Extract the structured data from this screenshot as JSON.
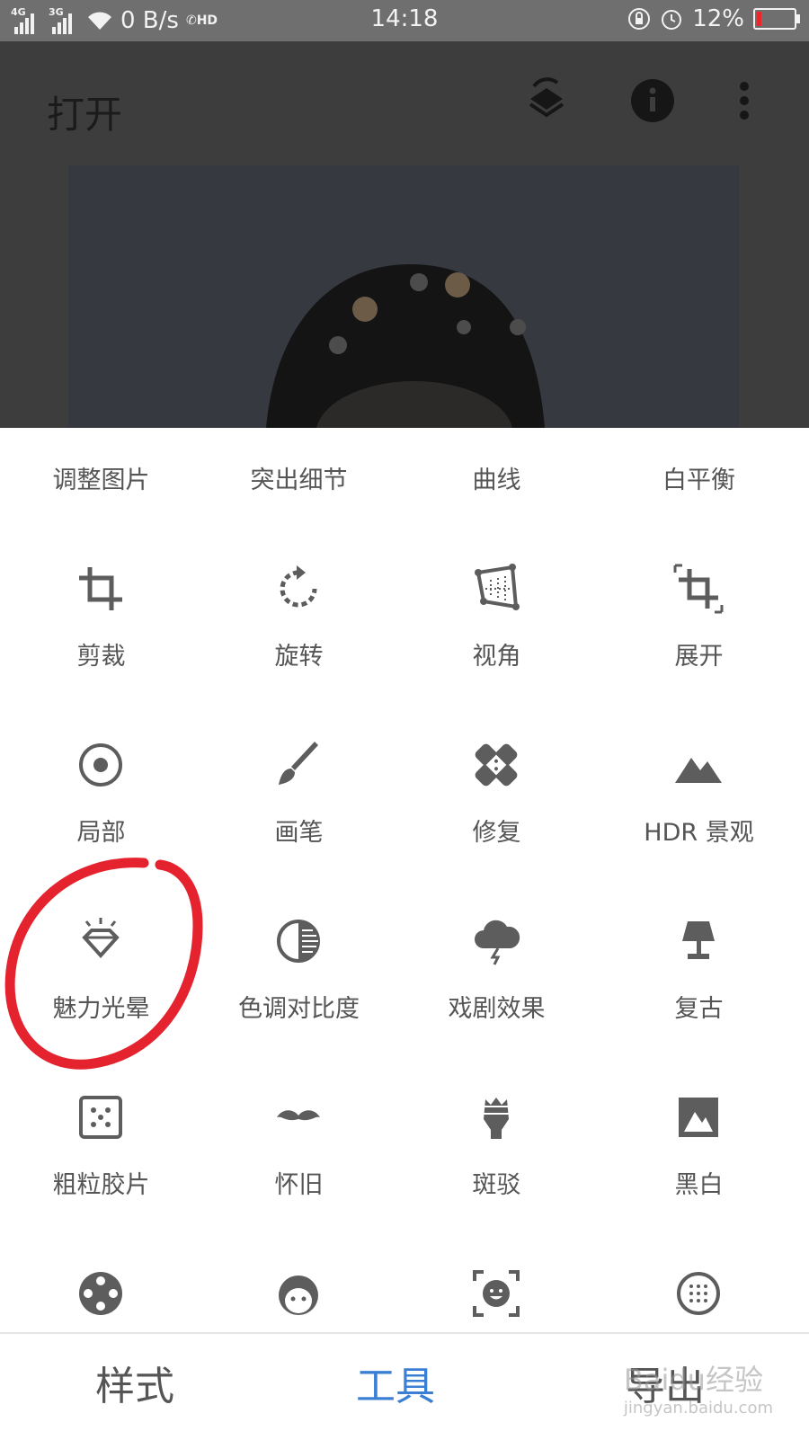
{
  "status_bar": {
    "signal1": "4G",
    "signal2": "3G",
    "speed": "0 B/s",
    "call": "HD",
    "time": "14:18",
    "battery": "12%",
    "battery_color": "#e8262b"
  },
  "header": {
    "title": "打开",
    "icons": [
      "layers-icon",
      "info-icon",
      "more-icon"
    ]
  },
  "tools": [
    {
      "label": "调整图片",
      "icon": "tune-icon"
    },
    {
      "label": "突出细节",
      "icon": "details-icon"
    },
    {
      "label": "曲线",
      "icon": "curves-icon"
    },
    {
      "label": "白平衡",
      "icon": "white-balance-icon"
    },
    {
      "label": "剪裁",
      "icon": "crop-icon"
    },
    {
      "label": "旋转",
      "icon": "rotate-icon"
    },
    {
      "label": "视角",
      "icon": "perspective-icon"
    },
    {
      "label": "展开",
      "icon": "expand-icon"
    },
    {
      "label": "局部",
      "icon": "selective-icon"
    },
    {
      "label": "画笔",
      "icon": "brush-icon"
    },
    {
      "label": "修复",
      "icon": "healing-icon"
    },
    {
      "label": "HDR 景观",
      "icon": "hdr-icon"
    },
    {
      "label": "魅力光晕",
      "icon": "glamour-glow-icon"
    },
    {
      "label": "色调对比度",
      "icon": "tonal-contrast-icon"
    },
    {
      "label": "戏剧效果",
      "icon": "drama-icon"
    },
    {
      "label": "复古",
      "icon": "vintage-icon"
    },
    {
      "label": "粗粒胶片",
      "icon": "grainy-film-icon"
    },
    {
      "label": "怀旧",
      "icon": "retrolux-icon"
    },
    {
      "label": "斑驳",
      "icon": "grunge-icon"
    },
    {
      "label": "黑白",
      "icon": "black-white-icon"
    },
    {
      "label": "",
      "icon": "noir-icon"
    },
    {
      "label": "",
      "icon": "portrait-icon"
    },
    {
      "label": "",
      "icon": "face-pose-icon"
    },
    {
      "label": "",
      "icon": "lens-blur-icon"
    }
  ],
  "bottom_nav": {
    "styles": "样式",
    "tools": "工具",
    "export": "导出",
    "active_color": "#3b7fd4"
  },
  "watermark": {
    "text": "Baidu经验",
    "url": "jingyan.baidu.com"
  }
}
